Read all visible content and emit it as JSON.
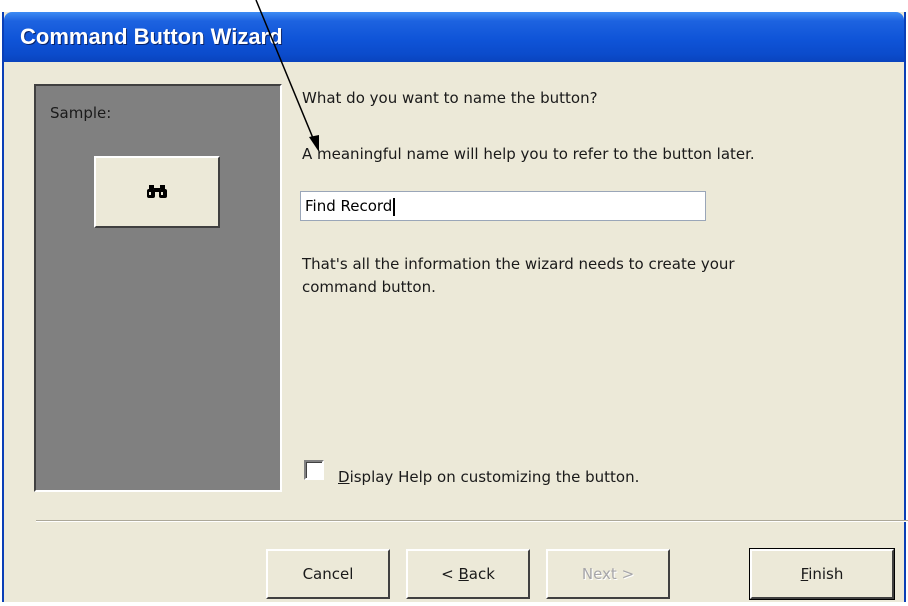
{
  "window": {
    "title": "Command Button Wizard"
  },
  "sample": {
    "label": "Sample:",
    "button_icon": "binoculars-icon"
  },
  "main": {
    "question": "What do you want to name the button?",
    "hint": "A meaningful name will help you to refer to the button later.",
    "name_value": "Find Record",
    "info": [
      "That's all the information the wizard needs to create your",
      "command button."
    ],
    "checkbox": {
      "label_mnemonic": "D",
      "label_rest": "isplay Help on customizing the button.",
      "checked": false
    }
  },
  "buttons": {
    "cancel": "Cancel",
    "back_prefix": "< ",
    "back_mnemonic": "B",
    "back_rest": "ack",
    "next": "Next >",
    "finish_mnemonic": "F",
    "finish_rest": "inish"
  },
  "colors": {
    "title_bar": "#0f54d8",
    "dialog_bg": "#ece9d8",
    "sample_panel": "#808080"
  }
}
